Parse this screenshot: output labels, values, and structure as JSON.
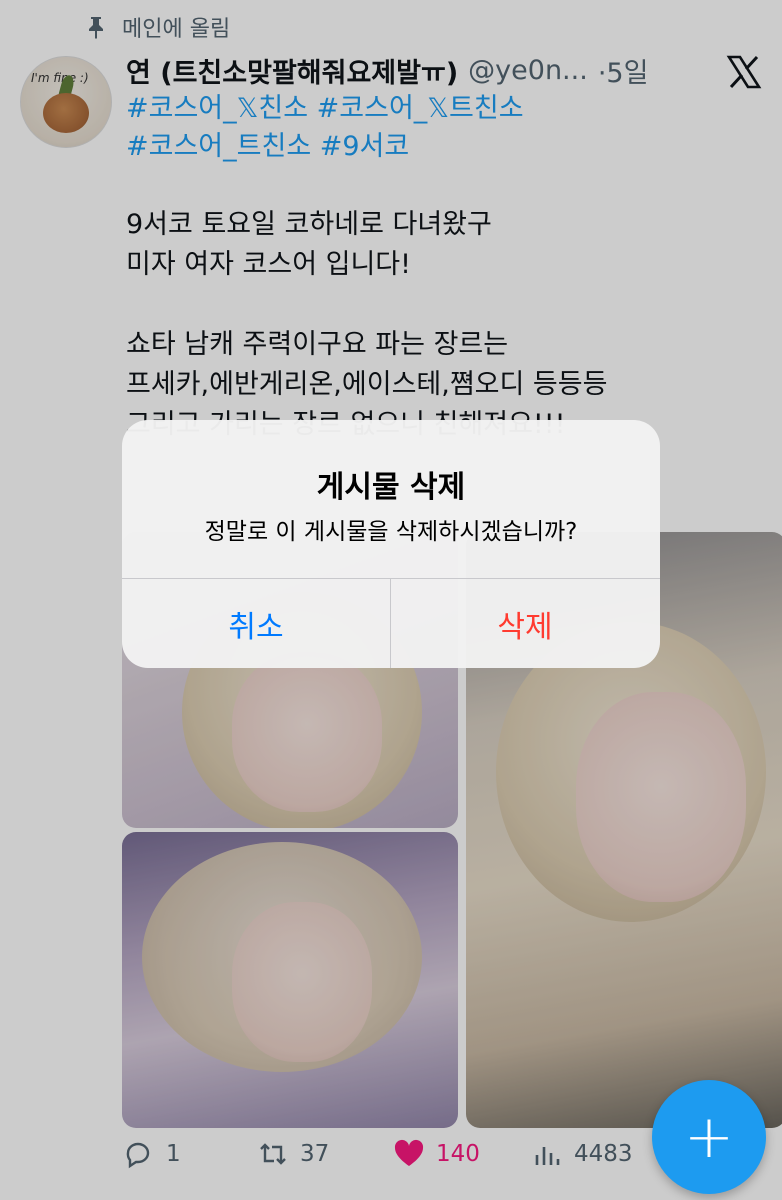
{
  "pinned": {
    "label": "메인에 올림"
  },
  "author": {
    "name": "연 (트친소맞팔해줘요제발ㅠ)",
    "handle": "@ye0n...",
    "time": "·5일"
  },
  "tweet": {
    "hashtags": [
      "#코스어_𝕏친소 #코스어_𝕏트친소",
      "#코스어_트친소 #9서코"
    ],
    "lines_1": [
      "9서코 토요일 코하네로 다녀왔구",
      "미자 여자 코스어 입니다!"
    ],
    "lines_2": [
      "쇼타 남캐 주력이구요 파는 장르는",
      "프세카,에반게리온,에이스테,쪔오디 등등등",
      "그리고 가리는 장르 없으니 친해져요!!!"
    ]
  },
  "dialog": {
    "title": "게시물 삭제",
    "message": "정말로 이 게시물을 삭제하시겠습니까?",
    "cancel": "취소",
    "confirm": "삭제"
  },
  "actions": {
    "replies": "1",
    "reposts": "37",
    "likes": "140",
    "views": "4483"
  },
  "fab": {
    "label": "+"
  },
  "colors": {
    "link": "#1d9bf0",
    "destructive": "#ff3b30",
    "ios_blue": "#007aff",
    "like": "#f91880"
  },
  "icons": [
    "pin-icon",
    "x-logo-icon",
    "reply-icon",
    "repost-icon",
    "heart-icon",
    "views-icon",
    "compose-icon"
  ]
}
